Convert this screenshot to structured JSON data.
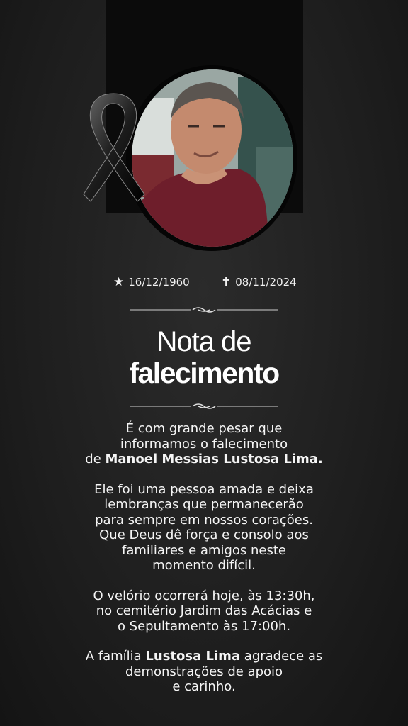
{
  "colors": {
    "background": "#1e1e1e",
    "band": "#0b0b0b",
    "text": "#ffffff"
  },
  "icons": {
    "ribbon": "mourning-ribbon-icon",
    "birth": "star-icon",
    "death": "cross-icon",
    "divider": "ornament-divider-icon"
  },
  "dates": {
    "birth_symbol": "★",
    "birth": "16/12/1960",
    "death_symbol": "✝",
    "death": "08/11/2024"
  },
  "title": {
    "line1": "Nota de",
    "line2": "falecimento"
  },
  "message": {
    "p1_line1": "É com grande pesar  que",
    "p1_line2": "informamos o falecimento",
    "p1_line3_prefix": "de ",
    "p1_name": "Manoel Messias Lustosa Lima.",
    "p2_line1": "Ele foi uma pessoa amada e deixa",
    "p2_line2": "lembranças que permanecerão",
    "p2_line3": "para sempre em nossos corações.",
    "p2_line4": "Que Deus dê força e consolo aos",
    "p2_line5": "familiares e amigos neste",
    "p2_line6": "momento difícil.",
    "p3_line1": "O velório ocorrerá hoje, às 13:30h,",
    "p3_line2": "no cemitério Jardim das Acácias e",
    "p3_line3": "o Sepultamento às 17:00h.",
    "p4_prefix": "A família ",
    "p4_family": "Lustosa Lima",
    "p4_suffix": " agradece as",
    "p4_line2": "demonstrações de apoio",
    "p4_line3": "e carinho."
  }
}
